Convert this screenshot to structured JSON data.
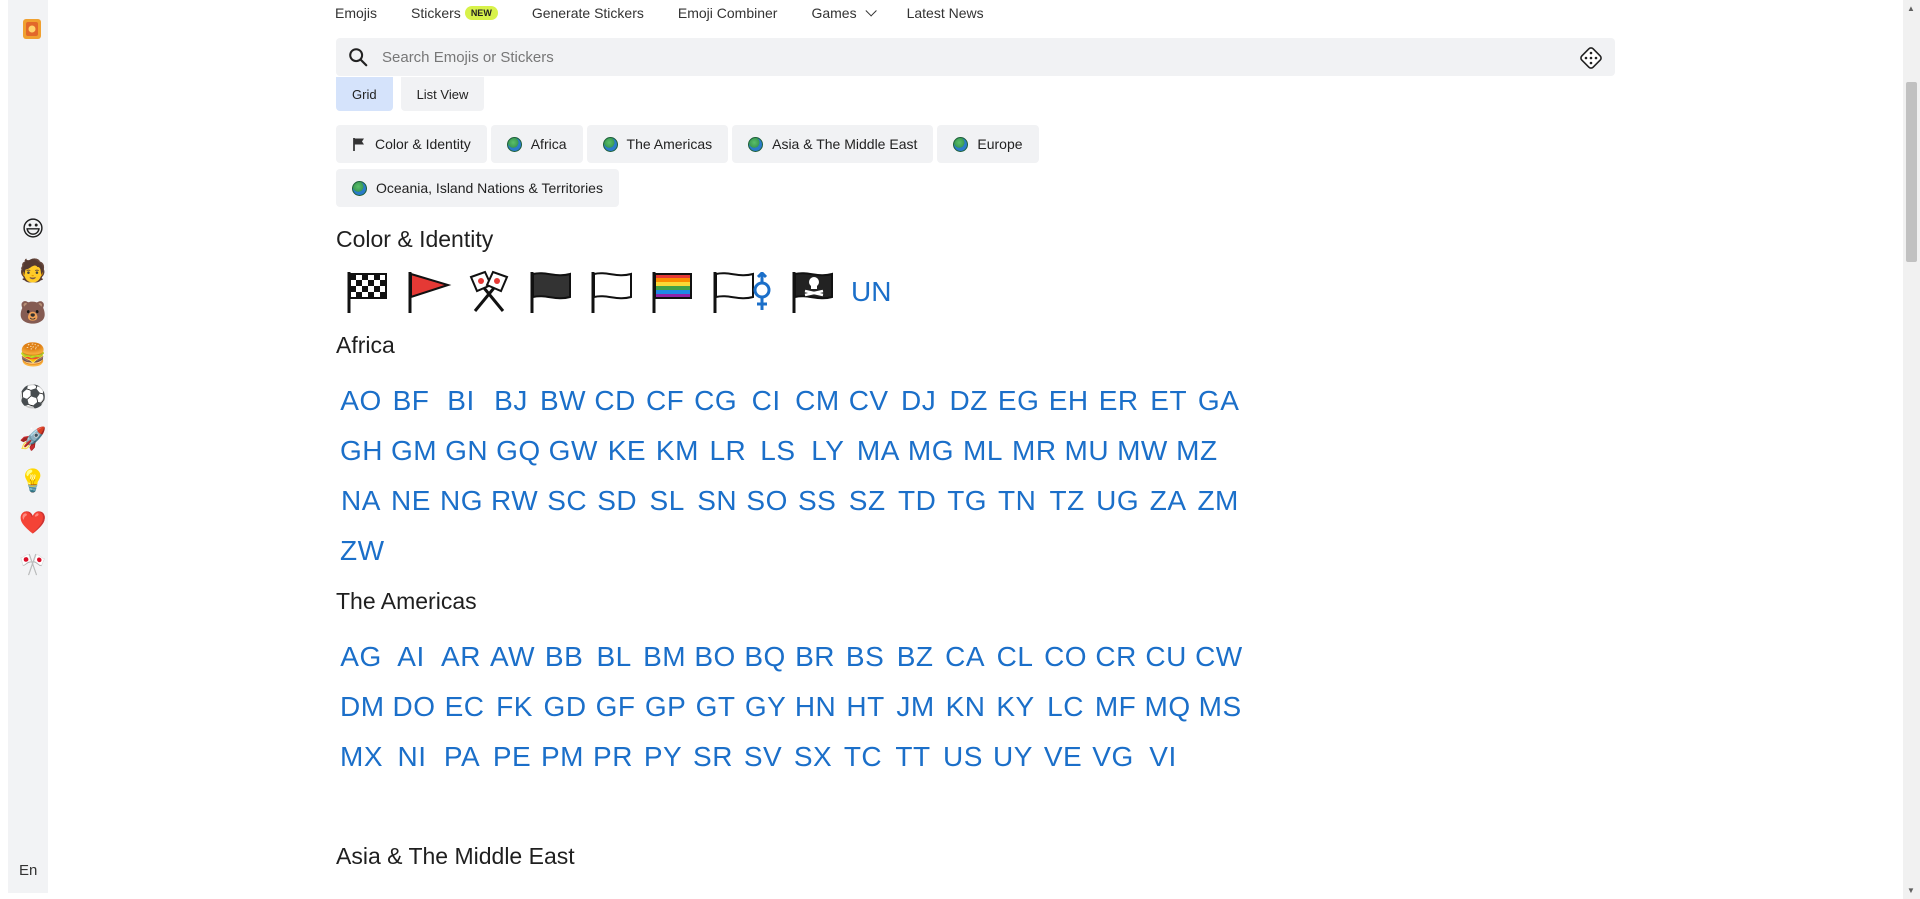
{
  "rail": {
    "language": "En",
    "icons": [
      "smiley-icon",
      "person-icon",
      "bear-icon",
      "burger-icon",
      "soccer-ball-icon",
      "rocket-icon",
      "lightbulb-icon",
      "heart-icon",
      "crossed-flags-icon"
    ],
    "glyphs": [
      "😃",
      "🧑",
      "🐻",
      "🍔",
      "⚽",
      "🚀",
      "💡",
      "❤️",
      "🎌"
    ]
  },
  "nav": {
    "items": [
      {
        "label": "Emojis"
      },
      {
        "label": "Stickers",
        "badge": "NEW"
      },
      {
        "label": "Generate Stickers"
      },
      {
        "label": "Emoji Combiner"
      },
      {
        "label": "Games"
      },
      {
        "label": "Latest News"
      }
    ]
  },
  "search": {
    "placeholder": "Search Emojis or Stickers"
  },
  "view": {
    "grid": "Grid",
    "list": "List View"
  },
  "filters": [
    {
      "label": "Color & Identity",
      "icon": "flag-icon"
    },
    {
      "label": "Africa",
      "icon": "globe-icon"
    },
    {
      "label": "The Americas",
      "icon": "globe-icon"
    },
    {
      "label": "Asia & The Middle East",
      "icon": "globe-icon"
    },
    {
      "label": "Europe",
      "icon": "globe-icon"
    },
    {
      "label": "Oceania, Island Nations & Territories",
      "icon": "globe-icon"
    }
  ],
  "sections": {
    "color_identity": {
      "title": "Color & Identity",
      "flags": [
        "chequered-flag-icon",
        "triangular-flag-icon",
        "crossed-flags-icon",
        "black-flag-icon",
        "white-flag-icon",
        "rainbow-flag-icon",
        "transgender-flag-icon",
        "pirate-flag-icon"
      ],
      "un": "UN"
    },
    "africa": {
      "title": "Africa",
      "codes": [
        "AO",
        "BF",
        "BI",
        "BJ",
        "BW",
        "CD",
        "CF",
        "CG",
        "CI",
        "CM",
        "CV",
        "DJ",
        "DZ",
        "EG",
        "EH",
        "ER",
        "ET",
        "GA",
        "GH",
        "GM",
        "GN",
        "GQ",
        "GW",
        "KE",
        "KM",
        "LR",
        "LS",
        "LY",
        "MA",
        "MG",
        "ML",
        "MR",
        "MU",
        "MW",
        "MZ",
        "NA",
        "NE",
        "NG",
        "RW",
        "SC",
        "SD",
        "SL",
        "SN",
        "SO",
        "SS",
        "SZ",
        "TD",
        "TG",
        "TN",
        "TZ",
        "UG",
        "ZA",
        "ZM",
        "ZW"
      ]
    },
    "americas": {
      "title": "The Americas",
      "codes": [
        "AG",
        "AI",
        "AR",
        "AW",
        "BB",
        "BL",
        "BM",
        "BO",
        "BQ",
        "BR",
        "BS",
        "BZ",
        "CA",
        "CL",
        "CO",
        "CR",
        "CU",
        "CW",
        "DM",
        "DO",
        "EC",
        "FK",
        "GD",
        "GF",
        "GP",
        "GT",
        "GY",
        "HN",
        "HT",
        "JM",
        "KN",
        "KY",
        "LC",
        "MF",
        "MQ",
        "MS",
        "MX",
        "NI",
        "PA",
        "PE",
        "PM",
        "PR",
        "PY",
        "SR",
        "SV",
        "SX",
        "TC",
        "TT",
        "US",
        "UY",
        "VE",
        "VG",
        "VI"
      ]
    },
    "asia": {
      "title": "Asia & The Middle East"
    }
  },
  "colors": {
    "link": "#1b6fc9",
    "chip_bg": "#f1f2f4",
    "active_view": "#d5e3fb",
    "badge": "#d8f24a"
  }
}
